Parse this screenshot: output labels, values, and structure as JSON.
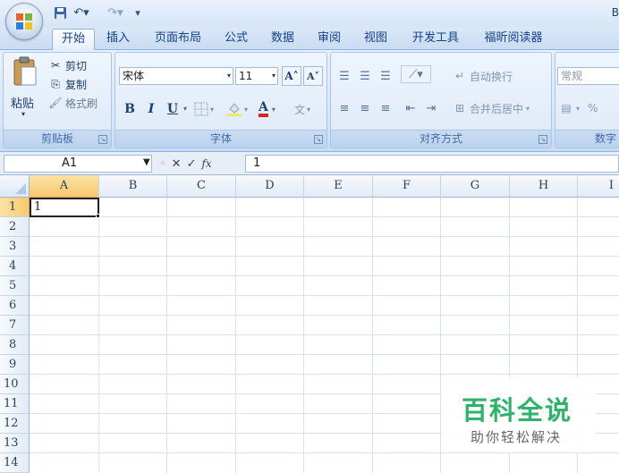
{
  "window": {
    "title_fragment": "B"
  },
  "ribbon_tabs": [
    "开始",
    "插入",
    "页面布局",
    "公式",
    "数据",
    "审阅",
    "视图",
    "开发工具",
    "福昕阅读器"
  ],
  "clipboard_group": {
    "paste_label": "粘贴",
    "cut_label": "剪切",
    "copy_label": "复制",
    "format_painter_label": "格式刷",
    "group_label": "剪贴板"
  },
  "font_group": {
    "font_name": "宋体",
    "font_size": "11",
    "bold": "B",
    "italic": "I",
    "underline": "U",
    "font_color_letter": "A",
    "group_label": "字体"
  },
  "alignment_group": {
    "wrap_text_label": "自动换行",
    "merge_center_label": "合并后居中",
    "group_label": "对齐方式"
  },
  "number_group": {
    "format_value": "常规",
    "percent_symbol": "%",
    "group_label": "数字"
  },
  "formula_bar": {
    "cell_reference": "A1",
    "fx_label": "fx",
    "formula_value": "1"
  },
  "sheet": {
    "columns": [
      "A",
      "B",
      "C",
      "D",
      "E",
      "F",
      "G",
      "H",
      "I"
    ],
    "rows": [
      "1",
      "2",
      "3",
      "4",
      "5",
      "6",
      "7",
      "8",
      "9",
      "10",
      "11",
      "12",
      "13",
      "14"
    ],
    "selected_cell": "A1",
    "cells": {
      "A1": "1"
    }
  },
  "watermark": {
    "title": "百科全说",
    "subtitle": "助你轻松解决"
  },
  "colors": {
    "ribbon_blue": "#d8e6f7",
    "selected_header": "#f8c870",
    "watermark_green": "#2db36a"
  }
}
